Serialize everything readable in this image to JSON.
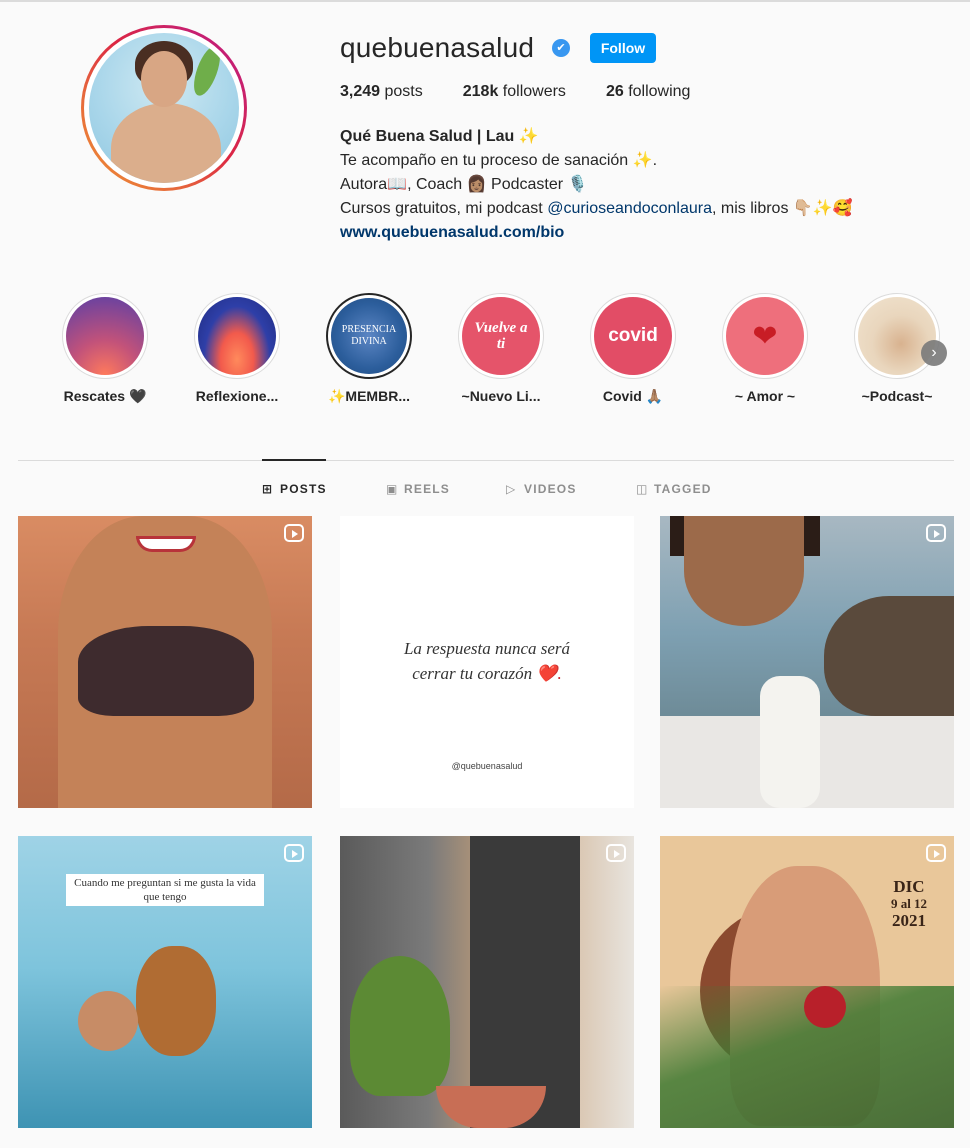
{
  "profile": {
    "username": "quebuenasalud",
    "verified_mark": "✔",
    "follow_label": "Follow",
    "stats": [
      {
        "count": "3,249",
        "label": "posts"
      },
      {
        "count": "218k",
        "label": "followers"
      },
      {
        "count": "26",
        "label": "following"
      }
    ],
    "bio": {
      "name": "Qué Buena Salud | Lau ✨",
      "line1": "Te acompaño en tu proceso de sanación ✨.",
      "line2": "Autora📖, Coach 👩🏽 Podcaster 🎙️",
      "line3_prefix": "Cursos gratuitos, mi podcast ",
      "line3_mention": "@curioseandoconlaura",
      "line3_suffix": ", mis libros 👇🏼✨🥰",
      "link": "www.quebuenasalud.com/bio"
    }
  },
  "highlights": [
    {
      "label": "Rescates 🖤",
      "image_text": ""
    },
    {
      "label": "Reflexione...",
      "image_text": ""
    },
    {
      "label": "✨MEMBR...",
      "image_text": "PRESENCIA DIVINA"
    },
    {
      "label": "~Nuevo Li...",
      "image_text": "Vuelve a ti"
    },
    {
      "label": "Covid 🙏🏽",
      "image_text": "covid"
    },
    {
      "label": "~ Amor ~",
      "image_text": ""
    },
    {
      "label": "~Podcast~",
      "image_text": ""
    }
  ],
  "highlights_next_icon": "›",
  "tabs": [
    {
      "label": "POSTS",
      "icon": "⊞",
      "active": true
    },
    {
      "label": "REELS",
      "icon": "▣",
      "active": false
    },
    {
      "label": "VIDEOS",
      "icon": "▷",
      "active": false
    },
    {
      "label": "TAGGED",
      "icon": "◫",
      "active": false
    }
  ],
  "posts": {
    "p2": {
      "quote_line1": "La respuesta nunca será",
      "quote_line2": "cerrar tu corazón",
      "heart": "❤️.",
      "handle": "@quebuenasalud"
    },
    "p4": {
      "caption": "Cuando me preguntan si me gusta la vida que tengo"
    },
    "p6": {
      "date_line1": "DIC",
      "date_line2": "9 al 12",
      "date_line3": "2021"
    }
  },
  "colors": {
    "accent": "#0095f6",
    "verified": "#3897f0",
    "link": "#00376b"
  }
}
